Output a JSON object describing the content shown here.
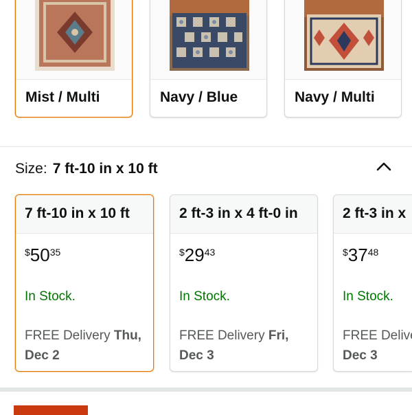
{
  "color_options": [
    {
      "label": "Mist / Multi",
      "selected": true,
      "palette": [
        "#b9765a",
        "#7a3b2e",
        "#d8c4a6",
        "#5b7c8a"
      ]
    },
    {
      "label": "Navy / Blue",
      "selected": false,
      "palette": [
        "#3a4a66",
        "#7d8ba4",
        "#c9c1ae",
        "#1f2a40"
      ]
    },
    {
      "label": "Navy / Multi",
      "selected": false,
      "palette": [
        "#c24f3a",
        "#2b3a5c",
        "#e2cdb0",
        "#8f5a3a"
      ]
    }
  ],
  "size": {
    "label": "Size:",
    "selected_value": "7 ft-10 in x 10 ft",
    "options": [
      {
        "title": "7 ft-10 in x 10 ft",
        "currency": "$",
        "whole": "50",
        "fraction": "35",
        "stock": "In Stock.",
        "delivery_prefix": "FREE Delivery ",
        "delivery_day": "Thu,",
        "delivery_date": "Dec 2",
        "selected": true
      },
      {
        "title": "2 ft-3 in x 4 ft-0 in",
        "currency": "$",
        "whole": "29",
        "fraction": "43",
        "stock": "In Stock.",
        "delivery_prefix": "FREE Delivery ",
        "delivery_day": "Fri,",
        "delivery_date": "Dec 3",
        "selected": false
      },
      {
        "title": "2 ft-3 in x",
        "currency": "$",
        "whole": "37",
        "fraction": "48",
        "stock": "In Stock.",
        "delivery_prefix": "FREE Delive",
        "delivery_day": "",
        "delivery_date": "Dec 3",
        "selected": false
      }
    ]
  },
  "icons": {
    "collapse": "chevron-up-icon"
  },
  "colors": {
    "accent": "#e77600",
    "stock": "#007600",
    "button": "#c8390d"
  }
}
